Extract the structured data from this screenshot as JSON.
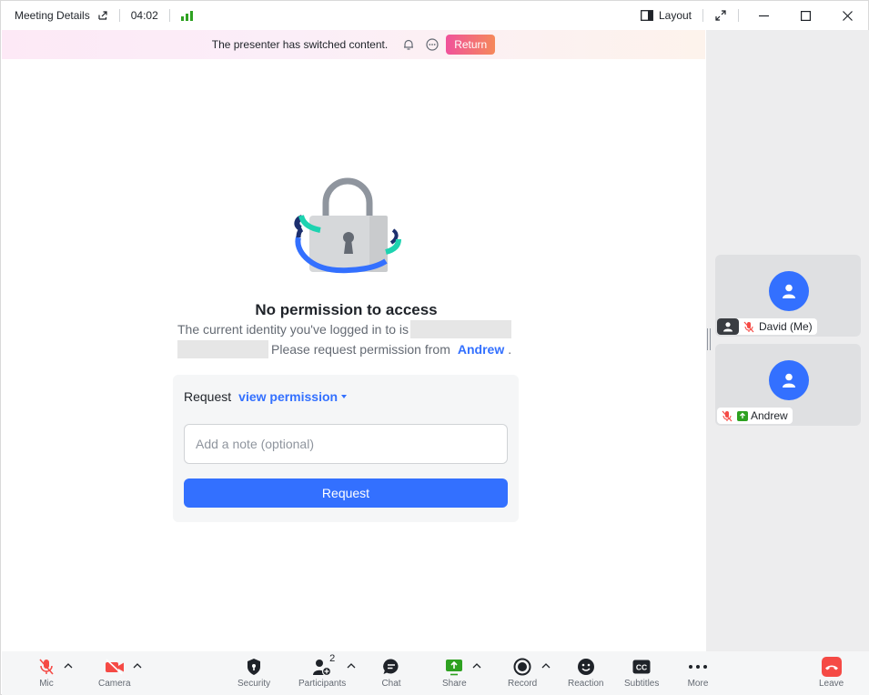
{
  "titlebar": {
    "title": "Meeting Details",
    "time": "04:02",
    "layout_label": "Layout"
  },
  "banner": {
    "text": "The presenter has switched content.",
    "return_label": "Return"
  },
  "main": {
    "title": "No permission to access",
    "line1": "The current identity you've logged in to is",
    "line2_prefix": "Please request permission from",
    "owner": "Andrew",
    "line2_suffix": "."
  },
  "request": {
    "label": "Request",
    "permission": "view permission",
    "note_placeholder": "Add a note (optional)",
    "button": "Request"
  },
  "participants": [
    {
      "name": "David (Me)",
      "host": true,
      "muted": true,
      "sharing": false
    },
    {
      "name": "Andrew",
      "host": false,
      "muted": true,
      "sharing": true
    }
  ],
  "toolbar": {
    "mic": "Mic",
    "camera": "Camera",
    "security": "Security",
    "participants": "Participants",
    "participants_count": "2",
    "chat": "Chat",
    "share": "Share",
    "record": "Record",
    "reaction": "Reaction",
    "subtitles": "Subtitles",
    "more": "More",
    "leave": "Leave"
  },
  "colors": {
    "accent": "#3370ff",
    "muted_red": "#f54a45",
    "signal_green": "#2ea121",
    "return_gradient_start": "#f0529b",
    "return_gradient_end": "#f5885a",
    "lock_teal": "#1dd3b0",
    "lock_navy": "#1c2f6e"
  },
  "icons": {
    "external": "external-link-icon",
    "signal": "signal-strength-icon",
    "layout": "layout-icon",
    "fullscreen": "fullscreen-icon",
    "bell": "bell-icon",
    "more": "more-dots-icon"
  }
}
